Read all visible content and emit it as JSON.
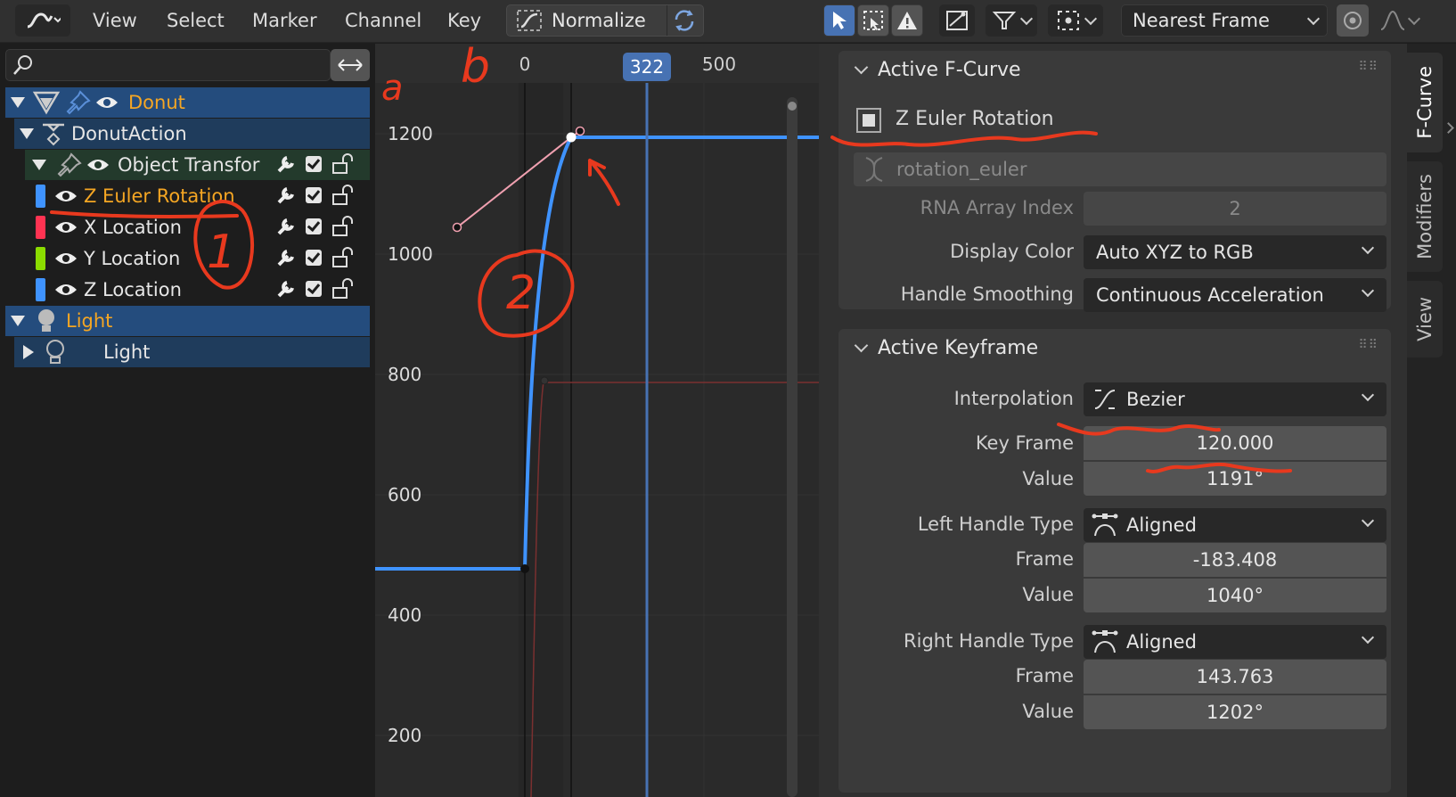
{
  "header": {
    "editor_type_icon": "graph-editor-icon",
    "menus": [
      "View",
      "Select",
      "Marker",
      "Channel",
      "Key"
    ],
    "normalize_label": "Normalize",
    "snap_mode": "Nearest Frame"
  },
  "channels": {
    "search_placeholder": "",
    "rows": [
      {
        "label": "Donut",
        "kind": "object",
        "color": "#f5a623"
      },
      {
        "label": "DonutAction",
        "kind": "action",
        "color": "#e6e6e6"
      },
      {
        "label": "Object Transfor",
        "kind": "group",
        "color": "#e6e6e6"
      },
      {
        "label": "Z Euler Rotation",
        "kind": "channel",
        "strip": "#3f93ff",
        "color": "#f5a623"
      },
      {
        "label": "X Location",
        "kind": "channel",
        "strip": "#ff3352",
        "color": "#e6e6e6"
      },
      {
        "label": "Y Location",
        "kind": "channel",
        "strip": "#8bdc00",
        "color": "#e6e6e6"
      },
      {
        "label": "Z Location",
        "kind": "channel",
        "strip": "#3f93ff",
        "color": "#e6e6e6"
      },
      {
        "label": "Light",
        "kind": "object",
        "color": "#f5a623"
      },
      {
        "label": "Light",
        "kind": "action",
        "color": "#e6e6e6"
      }
    ]
  },
  "graph": {
    "frame_labels": [
      "0",
      "500"
    ],
    "current_frame": "322",
    "value_labels": [
      "1200",
      "1000",
      "800",
      "600",
      "400",
      "200"
    ],
    "curve_color": "#3f93ff",
    "playhead_color": "#4772b3"
  },
  "sidebar": {
    "active_fcurve": {
      "title": "Active F-Curve",
      "channel_name": "Z Euler Rotation",
      "data_path": "rotation_euler",
      "rna_index_label": "RNA Array Index",
      "rna_index": "2",
      "display_color_label": "Display Color",
      "display_color": "Auto XYZ to RGB",
      "handle_smoothing_label": "Handle Smoothing",
      "handle_smoothing": "Continuous Acceleration"
    },
    "active_keyframe": {
      "title": "Active Keyframe",
      "interpolation_label": "Interpolation",
      "interpolation": "Bezier",
      "key_frame_label": "Key Frame",
      "key_frame": "120.000",
      "value_label": "Value",
      "value": "1191°",
      "left_handle_type_label": "Left Handle Type",
      "left_handle_type": "Aligned",
      "left_frame_label": "Frame",
      "left_frame": "-183.408",
      "left_value_label": "Value",
      "left_value": "1040°",
      "right_handle_type_label": "Right Handle Type",
      "right_handle_type": "Aligned",
      "right_frame_label": "Frame",
      "right_frame": "143.763",
      "right_value_label": "Value",
      "right_value": "1202°"
    }
  },
  "tabs": [
    "F-Curve",
    "Modifiers",
    "View"
  ],
  "annotations": {
    "letters": [
      "a",
      "b"
    ],
    "numbers": [
      "1",
      "2"
    ],
    "ink_color": "#e8391e"
  }
}
